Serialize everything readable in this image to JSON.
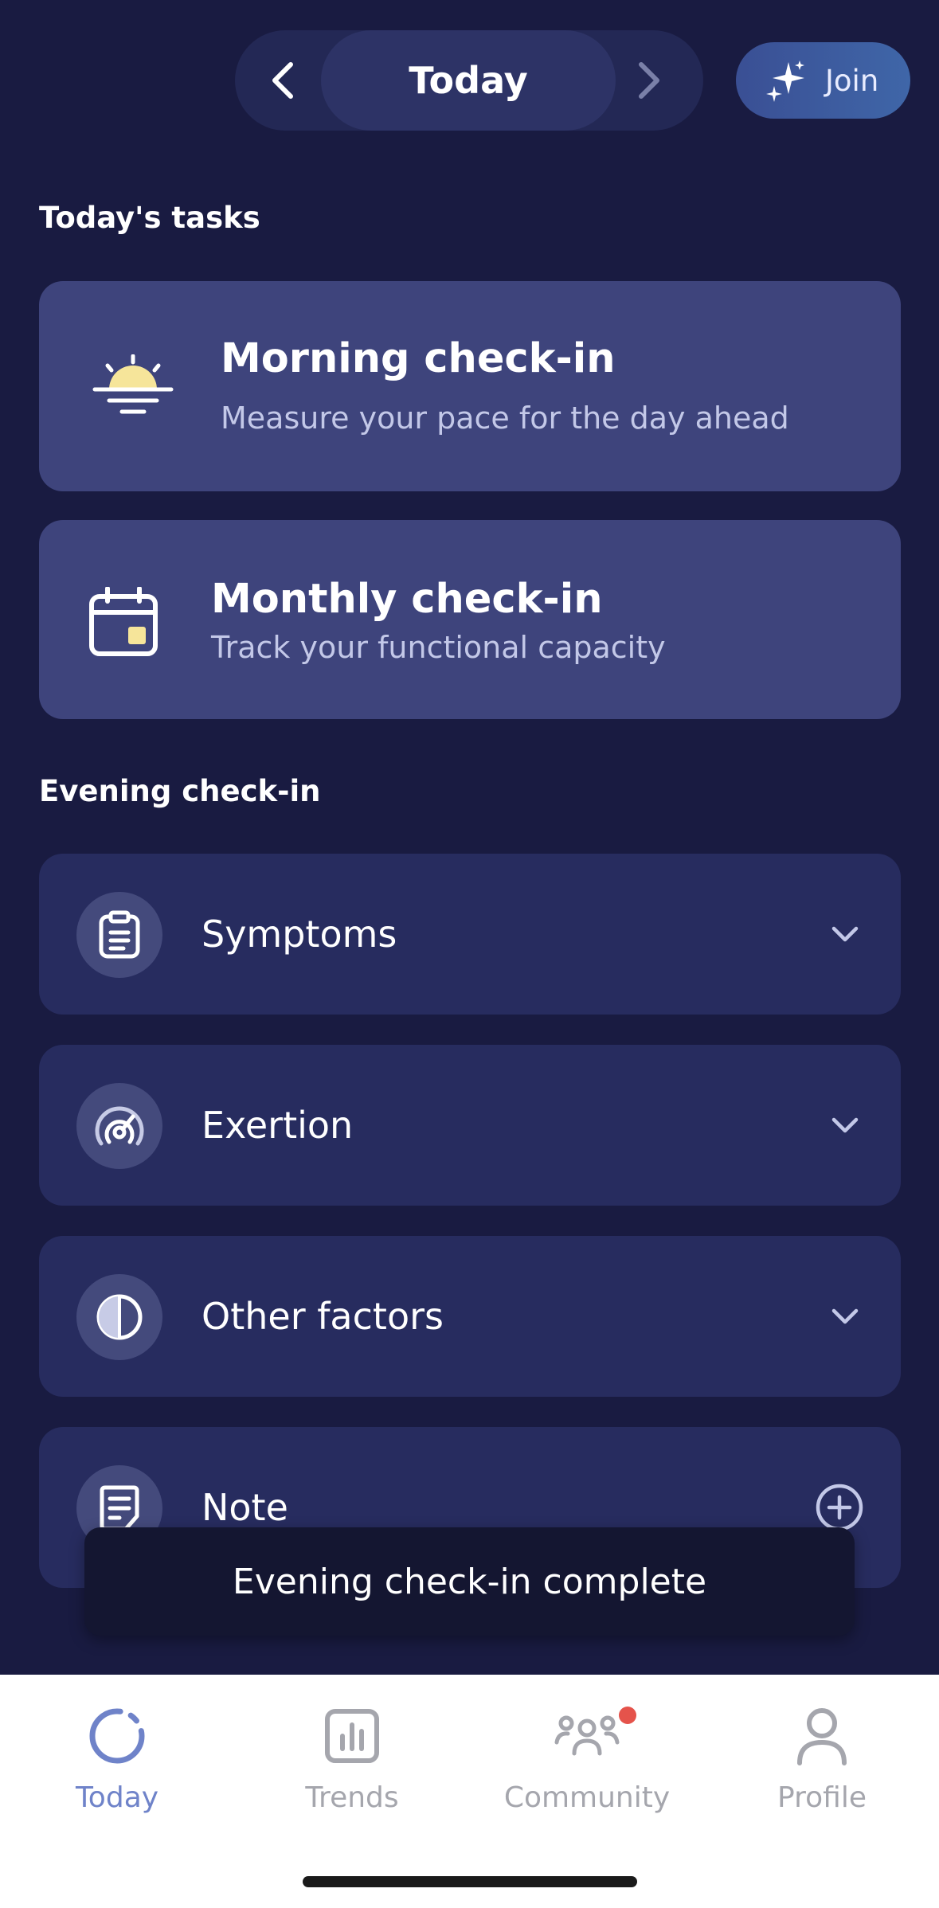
{
  "header": {
    "date_label": "Today",
    "join_label": "Join",
    "icons": {
      "prev": "chevron-left-icon",
      "next": "chevron-right-icon",
      "join": "sparkles-icon"
    }
  },
  "tasks": {
    "section_title": "Today's tasks",
    "items": [
      {
        "title": "Morning check-in",
        "subtitle": "Measure your pace for the day ahead",
        "icon": "sunrise-icon"
      },
      {
        "title": "Monthly check-in",
        "subtitle": "Track your functional capacity",
        "icon": "calendar-icon"
      }
    ]
  },
  "evening": {
    "section_title": "Evening check-in",
    "items": [
      {
        "label": "Symptoms",
        "icon": "clipboard-icon",
        "action": "chevron-down-icon"
      },
      {
        "label": "Exertion",
        "icon": "gauge-icon",
        "action": "chevron-down-icon"
      },
      {
        "label": "Other factors",
        "icon": "half-circle-icon",
        "action": "chevron-down-icon"
      },
      {
        "label": "Note",
        "icon": "note-icon",
        "action": "plus-circle-icon"
      }
    ]
  },
  "toast": {
    "message": "Evening check-in complete"
  },
  "tabbar": {
    "items": [
      {
        "label": "Today",
        "icon": "today-ring-icon",
        "active": true
      },
      {
        "label": "Trends",
        "icon": "bar-chart-icon",
        "active": false
      },
      {
        "label": "Community",
        "icon": "people-icon",
        "active": false,
        "badge": true
      },
      {
        "label": "Profile",
        "icon": "person-icon",
        "active": false
      }
    ]
  },
  "colors": {
    "background": "#191b41",
    "task_card": "#3e447c",
    "accordion": "#272c5f",
    "accent_active": "#6f83c9",
    "badge": "#e5534b",
    "sun": "#f6e59a"
  }
}
